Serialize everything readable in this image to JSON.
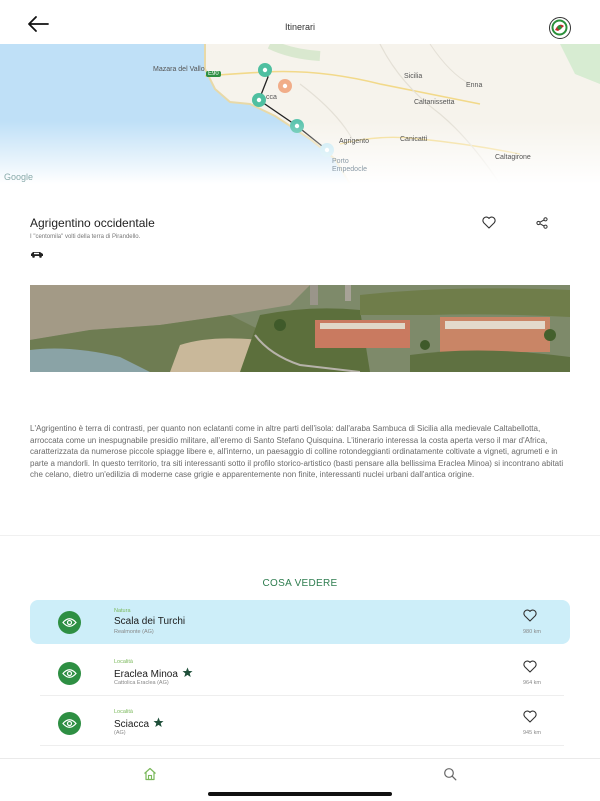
{
  "header": {
    "title": "Itinerari"
  },
  "map": {
    "labels": [
      "Mazara del Vallo",
      "E90",
      "Sicilia",
      "Caltanissetta",
      "Enna",
      "Canicattì",
      "Agrigento",
      "Porto Empedocle",
      "Caltagirone",
      "cca"
    ],
    "attribution": "Google"
  },
  "place": {
    "title": "Agrigentino occidentale",
    "subtitle": "I \"centomila\" volti della terra di Pirandello."
  },
  "description": "L'Agrigentino è terra di contrasti, per quanto non eclatanti come in altre parti dell'isola: dall'araba Sambuca di Sicilia alla medievale Caltabellotta, arroccata come un inespugnabile presidio militare, all'eremo di Santo Stefano Quisquina. L'itinerario interessa la costa aperta verso il mar d'Africa, caratterizzata da numerose piccole spiagge libere e, all'interno, un paesaggio di colline rotondeggianti ordinatamente coltivate a vigneti, agrumeti e in parte a mandorli. In questo territorio, tra siti interessanti sotto il profilo storico-artistico (basti pensare alla bellissima Eraclea Minoa) si incontrano abitati che celano, dietro un'edilizia di moderne case grigie e apparentemente non finite, interessanti nuclei urbani dall'antica origine.",
  "section_title": "COSA VEDERE",
  "items": [
    {
      "category": "Natura",
      "name": "Scala dei Turchi",
      "location": "Realmonte (AG)",
      "distance": "980 km",
      "starred": false,
      "active": true
    },
    {
      "category": "Località",
      "name": "Eraclea Minoa",
      "location": "Cattolica Eraclea (AG)",
      "distance": "964 km",
      "starred": true,
      "active": false
    },
    {
      "category": "Località",
      "name": "Sciacca",
      "location": "(AG)",
      "distance": "945 km",
      "starred": true,
      "active": false
    }
  ],
  "colors": {
    "accent": "#2e8f43",
    "active_row": "#cdeef9",
    "category": "#7ab85b",
    "sea": "#bfe0f7"
  }
}
